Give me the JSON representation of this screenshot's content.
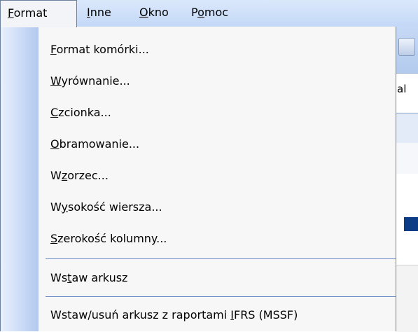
{
  "menubar": {
    "items": [
      {
        "pre": "",
        "key": "F",
        "post": "ormat"
      },
      {
        "pre": "",
        "key": "I",
        "post": "nne"
      },
      {
        "pre": "",
        "key": "O",
        "post": "kno"
      },
      {
        "pre": "P",
        "key": "o",
        "post": "moc"
      }
    ]
  },
  "background": {
    "font_combo_fragment": "al"
  },
  "menu": {
    "items": [
      {
        "pre": "",
        "key": "F",
        "post": "ormat komórki..."
      },
      {
        "pre": "",
        "key": "W",
        "post": "yrównanie..."
      },
      {
        "pre": "",
        "key": "C",
        "post": "zcionka..."
      },
      {
        "pre": "",
        "key": "O",
        "post": "bramowanie..."
      },
      {
        "pre": "W",
        "key": "z",
        "post": "orzec..."
      },
      {
        "pre": "W",
        "key": "y",
        "post": "sokość wiersza..."
      },
      {
        "pre": "",
        "key": "S",
        "post": "zerokość kolumny..."
      },
      {
        "pre": "Ws",
        "key": "t",
        "post": "aw arkusz"
      },
      {
        "pre": "Wstaw/usuń arkusz z raportami ",
        "key": "I",
        "post": "FRS (MSSF)"
      }
    ]
  }
}
